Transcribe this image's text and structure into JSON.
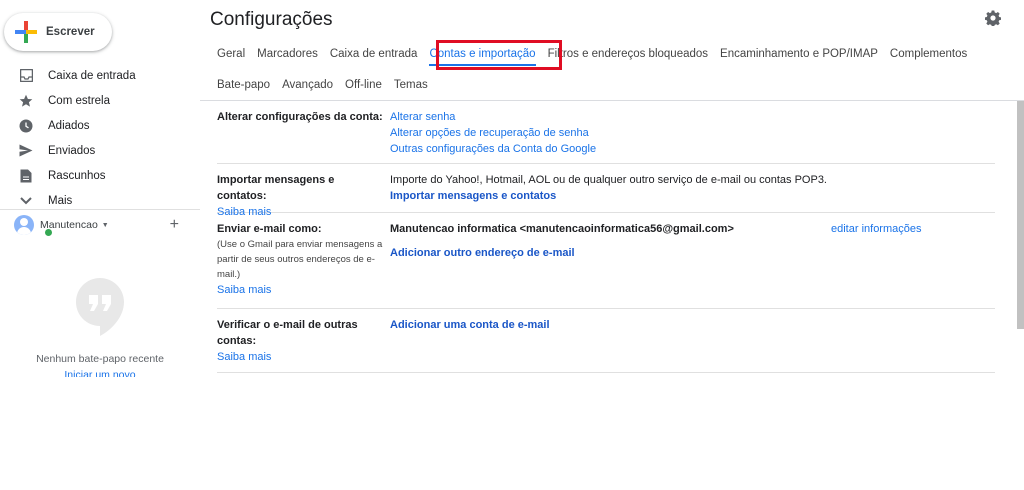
{
  "sidebar": {
    "compose_label": "Escrever",
    "items": [
      {
        "label": "Caixa de entrada",
        "icon": "inbox-icon"
      },
      {
        "label": "Com estrela",
        "icon": "star-icon"
      },
      {
        "label": "Adiados",
        "icon": "clock-icon"
      },
      {
        "label": "Enviados",
        "icon": "send-icon"
      },
      {
        "label": "Rascunhos",
        "icon": "draft-icon"
      },
      {
        "label": "Mais",
        "icon": "chevron-down-icon"
      }
    ],
    "account_name": "Manutencao",
    "no_chat": "Nenhum bate-papo recente",
    "start_new": "Iniciar um novo"
  },
  "header": {
    "title": "Configurações"
  },
  "tabs": {
    "row1": [
      "Geral",
      "Marcadores",
      "Caixa de entrada",
      "Contas e importação",
      "Filtros e endereços bloqueados",
      "Encaminhamento e POP/IMAP",
      "Complementos"
    ],
    "row2": [
      "Bate-papo",
      "Avançado",
      "Off-line",
      "Temas"
    ],
    "active": "Contas e importação"
  },
  "settings": {
    "change_account": {
      "label": "Alterar configurações da conta:",
      "links": [
        "Alterar senha",
        "Alterar opções de recuperação de senha",
        "Outras configurações da Conta do Google"
      ]
    },
    "import": {
      "label": "Importar mensagens e contatos:",
      "learn_more": "Saiba mais",
      "desc": "Importe do Yahoo!, Hotmail, AOL ou de qualquer outro serviço de e-mail ou contas POP3.",
      "action": "Importar mensagens e contatos"
    },
    "send_as": {
      "label": "Enviar e-mail como:",
      "desc": "(Use o Gmail para enviar mensagens a partir de seus outros endereços de e-mail.)",
      "learn_more": "Saiba mais",
      "address": "Manutencao informatica <manutencaoinformatica56@gmail.com>",
      "edit": "editar informações",
      "action": "Adicionar outro endereço de e-mail"
    },
    "check_mail": {
      "label": "Verificar o e-mail de outras contas:",
      "learn_more": "Saiba mais",
      "action": "Adicionar uma conta de e-mail"
    }
  },
  "colors": {
    "accent": "#1a73e8",
    "highlight": "#e00d23"
  }
}
